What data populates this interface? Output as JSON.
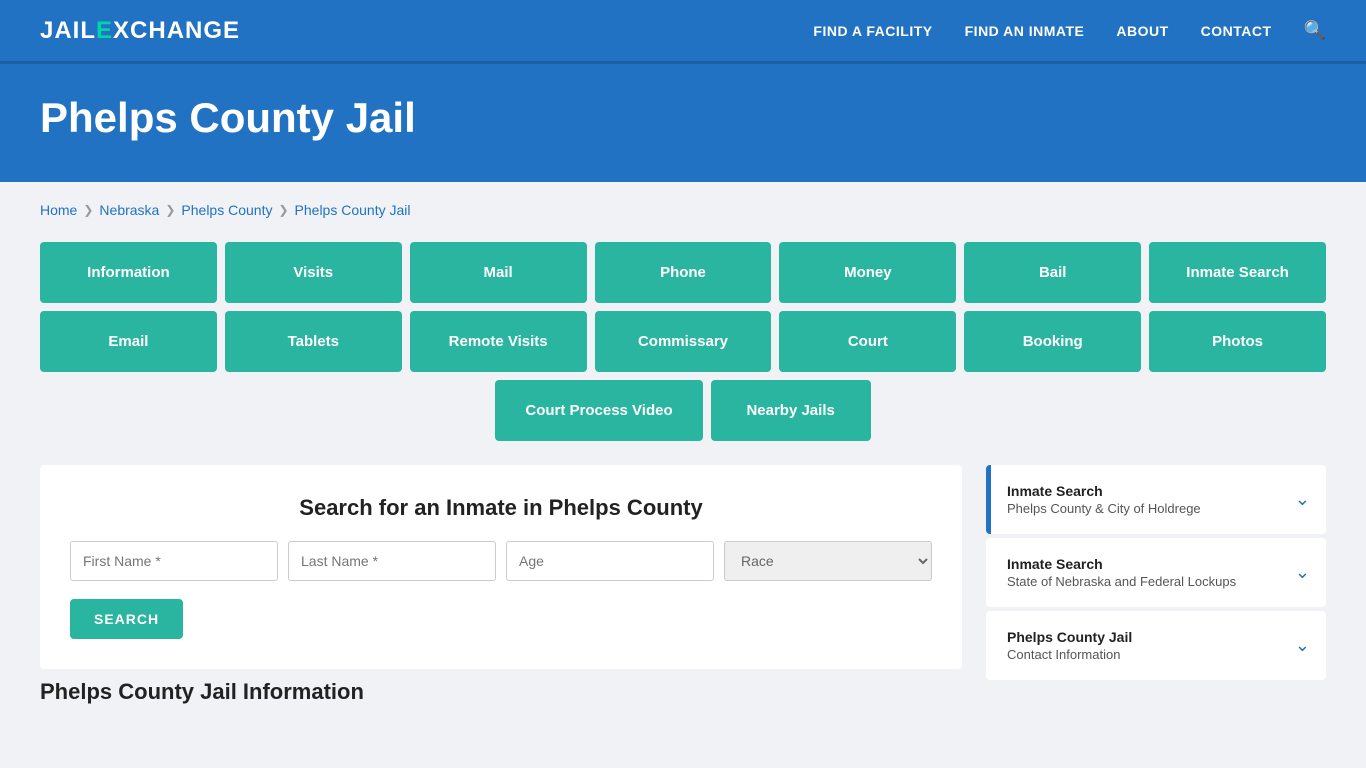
{
  "brand": {
    "name_part1": "JAIL",
    "name_part2": "E",
    "name_part3": "XCHANGE"
  },
  "navbar": {
    "links": [
      {
        "label": "FIND A FACILITY",
        "href": "#"
      },
      {
        "label": "FIND AN INMATE",
        "href": "#"
      },
      {
        "label": "ABOUT",
        "href": "#"
      },
      {
        "label": "CONTACT",
        "href": "#"
      }
    ]
  },
  "hero": {
    "title": "Phelps County Jail"
  },
  "breadcrumb": {
    "items": [
      "Home",
      "Nebraska",
      "Phelps County",
      "Phelps County Jail"
    ]
  },
  "grid_row1": [
    {
      "label": "Information"
    },
    {
      "label": "Visits"
    },
    {
      "label": "Mail"
    },
    {
      "label": "Phone"
    },
    {
      "label": "Money"
    },
    {
      "label": "Bail"
    },
    {
      "label": "Inmate Search"
    }
  ],
  "grid_row2": [
    {
      "label": "Email"
    },
    {
      "label": "Tablets"
    },
    {
      "label": "Remote Visits"
    },
    {
      "label": "Commissary"
    },
    {
      "label": "Court"
    },
    {
      "label": "Booking"
    },
    {
      "label": "Photos"
    }
  ],
  "grid_row3": [
    {
      "label": "Court Process Video"
    },
    {
      "label": "Nearby Jails"
    }
  ],
  "search": {
    "title": "Search for an Inmate in Phelps County",
    "first_name_placeholder": "First Name *",
    "last_name_placeholder": "Last Name *",
    "age_placeholder": "Age",
    "race_placeholder": "Race",
    "button_label": "SEARCH"
  },
  "info_section": {
    "title": "Phelps County Jail Information"
  },
  "sidebar": {
    "cards": [
      {
        "title": "Inmate Search",
        "subtitle": "Phelps County & City of Holdrege",
        "active": true
      },
      {
        "title": "Inmate Search",
        "subtitle": "State of Nebraska and Federal Lockups",
        "active": false
      },
      {
        "title": "Phelps County Jail",
        "subtitle": "Contact Information",
        "active": false
      }
    ]
  }
}
